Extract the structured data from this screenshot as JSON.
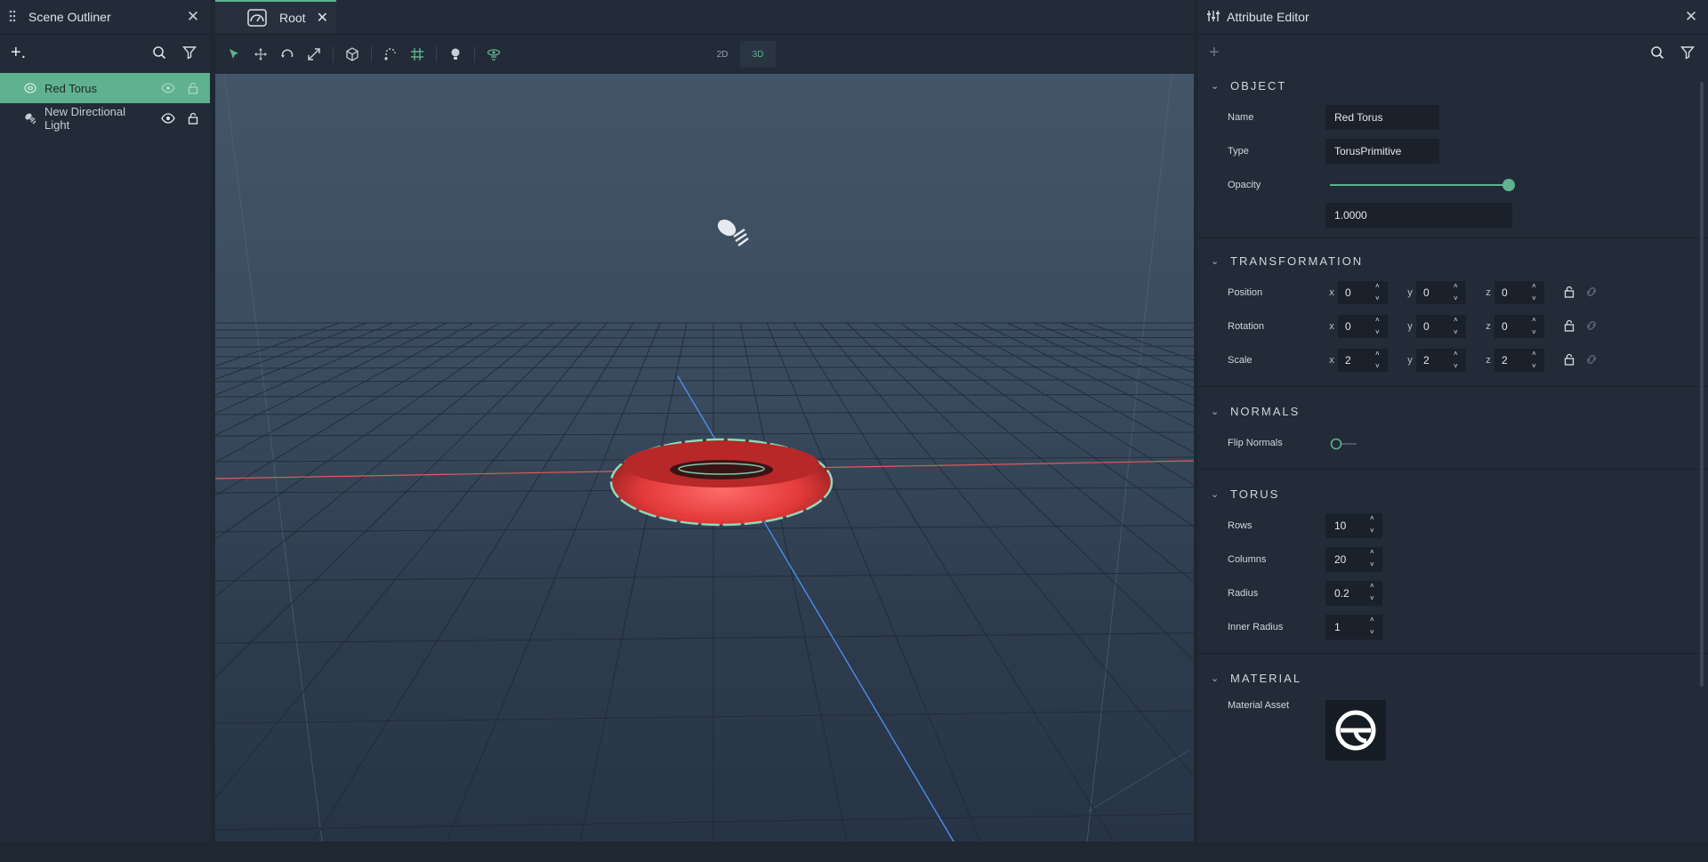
{
  "outliner": {
    "title": "Scene Outliner",
    "add_label": "+.",
    "items": [
      {
        "label": "Red Torus",
        "selected": true
      },
      {
        "label": "New Directional Light",
        "selected": false
      }
    ]
  },
  "tabs": [
    {
      "label": "Root"
    }
  ],
  "viewport": {
    "mode_2d": "2D",
    "mode_3d": "3D",
    "active_mode": "3D"
  },
  "attributes": {
    "title": "Attribute Editor",
    "object": {
      "heading": "OBJECT",
      "name_label": "Name",
      "name_value": "Red Torus",
      "type_label": "Type",
      "type_value": "TorusPrimitive",
      "opacity_label": "Opacity",
      "opacity_value": "1.0000",
      "opacity_level": 1.0
    },
    "transformation": {
      "heading": "TRANSFORMATION",
      "position_label": "Position",
      "rotation_label": "Rotation",
      "scale_label": "Scale",
      "position": {
        "x": "0",
        "y": "0",
        "z": "0"
      },
      "rotation": {
        "x": "0",
        "y": "0",
        "z": "0"
      },
      "scale": {
        "x": "2",
        "y": "2",
        "z": "2"
      },
      "axis_x": "x",
      "axis_y": "y",
      "axis_z": "z"
    },
    "normals": {
      "heading": "NORMALS",
      "flip_label": "Flip Normals",
      "flip_value": false
    },
    "torus": {
      "heading": "TORUS",
      "rows_label": "Rows",
      "rows_value": "10",
      "columns_label": "Columns",
      "columns_value": "20",
      "radius_label": "Radius",
      "radius_value": "0.2",
      "inner_radius_label": "Inner Radius",
      "inner_radius_value": "1"
    },
    "material": {
      "heading": "MATERIAL",
      "asset_label": "Material Asset"
    }
  },
  "colors": {
    "accent": "#5fb18f",
    "panel": "#222b37",
    "torus": "#e33a3a",
    "x_axis": "#e05a5a",
    "y_axis": "#4a8ee8"
  }
}
